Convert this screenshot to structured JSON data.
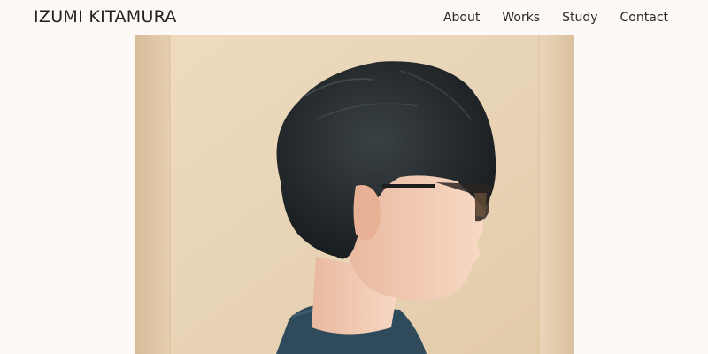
{
  "site": {
    "title": "IZUMI KITAMURA"
  },
  "nav": {
    "items": [
      {
        "label": "About"
      },
      {
        "label": "Works"
      },
      {
        "label": "Study"
      },
      {
        "label": "Contact"
      }
    ]
  },
  "colors": {
    "background": "#fcf9f7",
    "text": "#222222",
    "wall": "#e9d6b9",
    "hair": "#262b2e",
    "sweater": "#2f4a5b",
    "skin": "#f4cfb8"
  },
  "hero": {
    "image_icon": "portrait-photo"
  }
}
